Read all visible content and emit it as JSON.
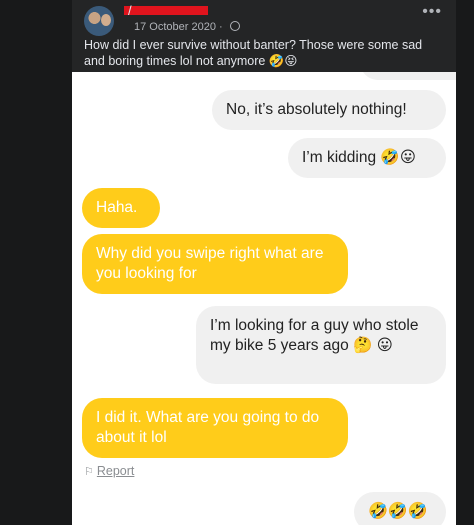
{
  "post": {
    "author_prefix": "/",
    "date": "17 October 2020 · ",
    "text": "How did I ever survive without banter? Those were some sad and boring times lol not anymore 🤣😝",
    "more_label": "•••"
  },
  "chat": {
    "messages": [
      {
        "side": "right",
        "text": "No, it’s absolutely nothing!"
      },
      {
        "side": "right",
        "text": "I’m kidding 🤣😛"
      },
      {
        "side": "left",
        "text": "Haha."
      },
      {
        "side": "left",
        "text": "Why did you swipe right what are you looking for"
      },
      {
        "side": "right",
        "text": "I’m looking for a guy who stole my bike 5 years ago 🤔 😛"
      },
      {
        "side": "left",
        "text": "I did it. What are you going to do about it lol"
      },
      {
        "side": "right",
        "text": "🤣🤣🤣"
      }
    ],
    "report_label": "Report"
  },
  "icons": {
    "avatar": "avatar-icon",
    "privacy": "globe-icon",
    "more": "more-options-icon",
    "report": "flag-icon"
  },
  "colors": {
    "page_bg": "#18191a",
    "card_bg": "#242526",
    "incoming_bubble": "#ffcc1a",
    "outgoing_bubble": "#f0f0f0"
  }
}
